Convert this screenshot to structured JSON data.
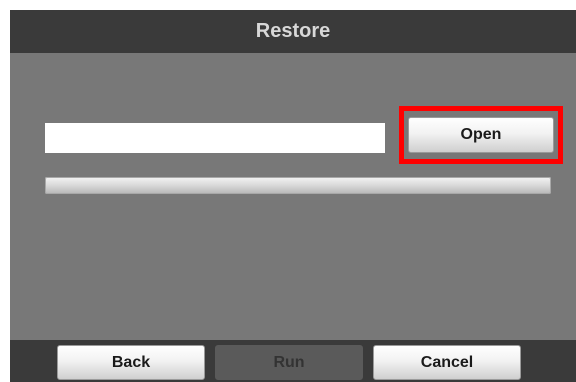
{
  "dialog": {
    "title": "Restore"
  },
  "file_input": {
    "value": "",
    "placeholder": ""
  },
  "open_button": {
    "label": "Open",
    "highlight_color": "#ff0000"
  },
  "progress": {
    "value_percent": 0
  },
  "footer": {
    "back_label": "Back",
    "run_label": "Run",
    "run_enabled": false,
    "cancel_label": "Cancel"
  },
  "colors": {
    "title_bar": "#3a3a3a",
    "panel": "#787878",
    "title_text": "#d8d8d8"
  }
}
